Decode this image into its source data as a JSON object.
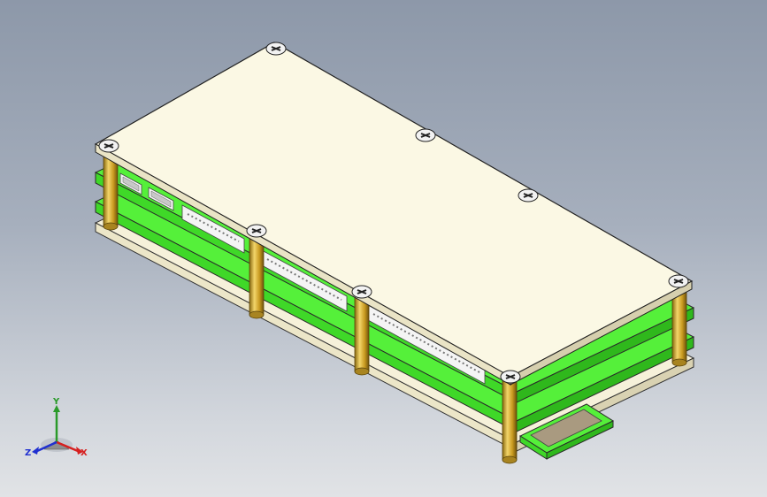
{
  "view": {
    "background_top": "#8d98a9",
    "background_bottom": "#e1e3e6"
  },
  "model": {
    "top_panel_color": "#fbf8e4",
    "pcb_color": "#55f03a",
    "standoff_color": "#d9b53a",
    "connector_color": "#f4f4f4",
    "pad_color": "#a99a80"
  },
  "triad": {
    "y_label": "Y",
    "x_label": "X",
    "z_label": "Z",
    "y_color": "#2a9a2a",
    "x_color": "#d62020",
    "z_color": "#2030d0"
  }
}
